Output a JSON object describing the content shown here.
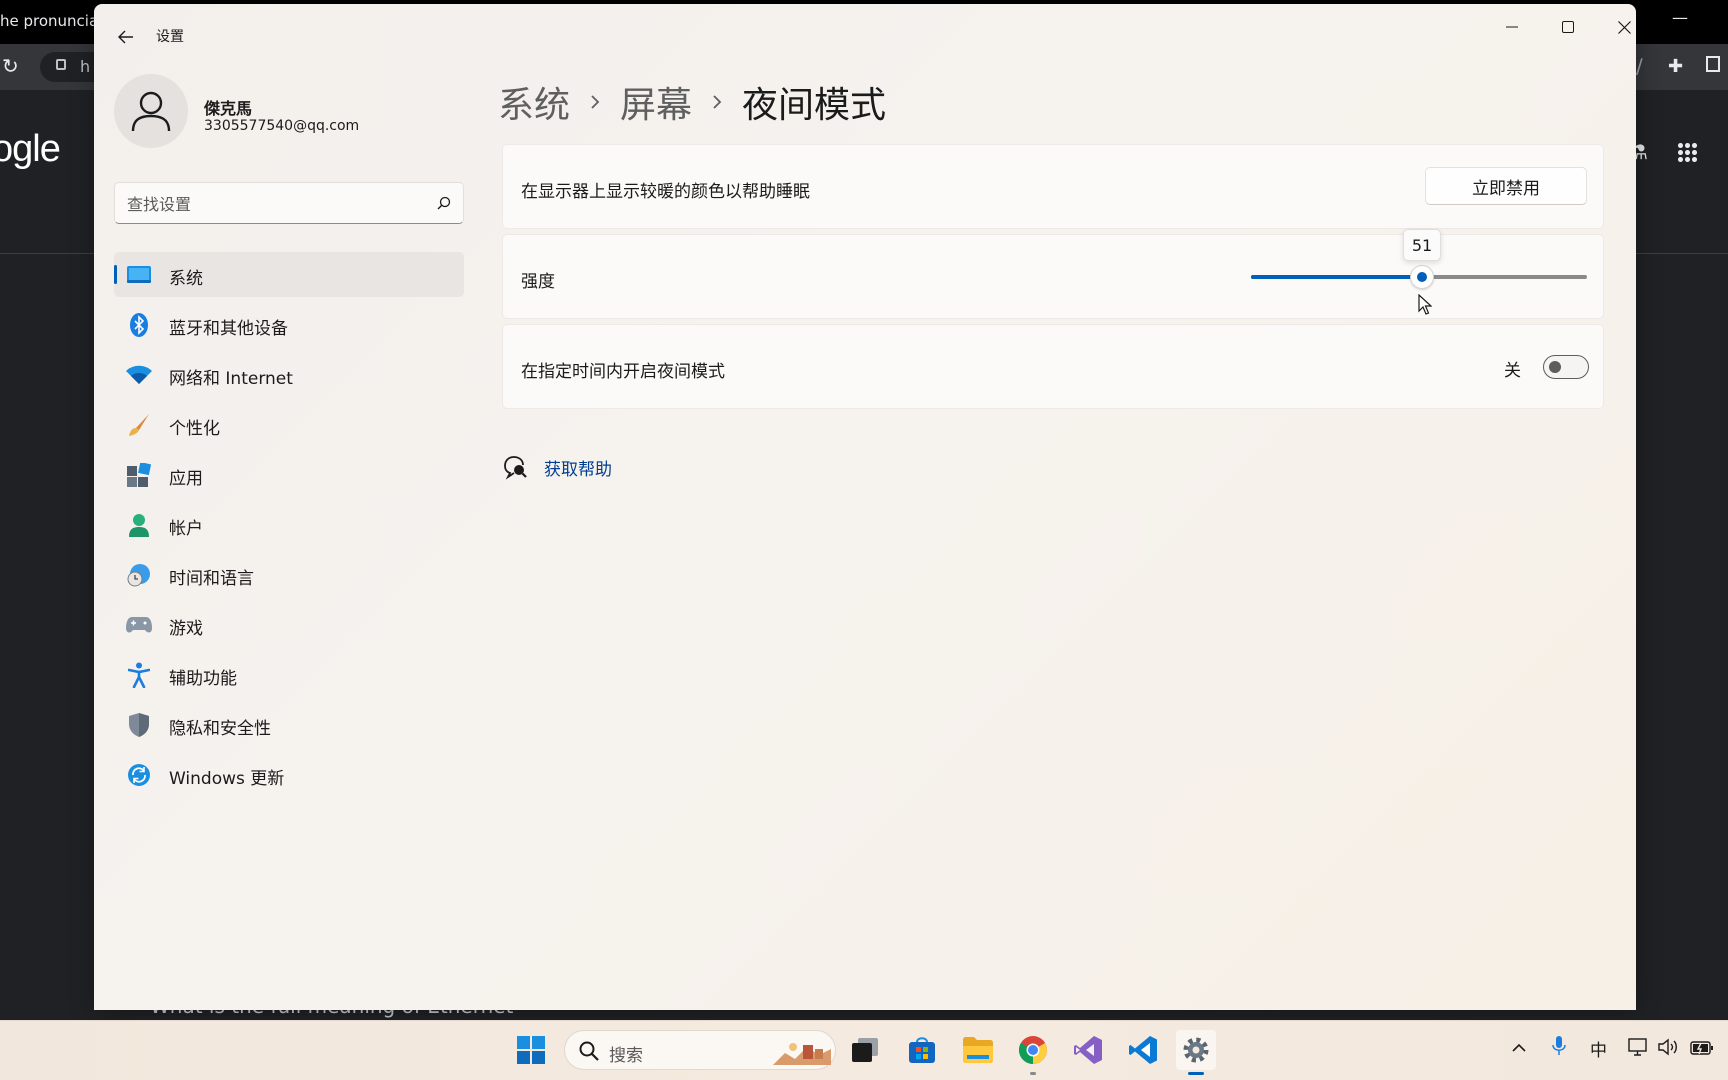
{
  "browser": {
    "tab_title": "he pronunciat",
    "url_fragment": "h",
    "logo_text": "ogle",
    "bottom_text": "What is the full meaning of Ethernet"
  },
  "window": {
    "app_title": "设置"
  },
  "profile": {
    "name": "傑克馬",
    "email": "3305577540@qq.com"
  },
  "search": {
    "placeholder": "查找设置"
  },
  "nav": {
    "items": [
      {
        "label": "系统",
        "icon": "system-icon",
        "active": true
      },
      {
        "label": "蓝牙和其他设备",
        "icon": "bluetooth-icon"
      },
      {
        "label": "网络和 Internet",
        "icon": "wifi-icon"
      },
      {
        "label": "个性化",
        "icon": "brush-icon"
      },
      {
        "label": "应用",
        "icon": "apps-icon"
      },
      {
        "label": "帐户",
        "icon": "account-icon"
      },
      {
        "label": "时间和语言",
        "icon": "globe-clock-icon"
      },
      {
        "label": "游戏",
        "icon": "gamepad-icon"
      },
      {
        "label": "辅助功能",
        "icon": "accessibility-icon"
      },
      {
        "label": "隐私和安全性",
        "icon": "shield-icon"
      },
      {
        "label": "Windows 更新",
        "icon": "update-icon"
      }
    ]
  },
  "breadcrumb": {
    "items": [
      "系统",
      "屏幕"
    ],
    "current": "夜间模式"
  },
  "night_light": {
    "description": "在显示器上显示较暖的颜色以帮助睡眠",
    "disable_button": "立即禁用",
    "strength_label": "强度",
    "strength_value": 51,
    "strength_text": "51",
    "schedule_label": "在指定时间内开启夜间模式",
    "schedule_state": "关",
    "schedule_on": false
  },
  "help": {
    "link": "获取帮助"
  },
  "taskbar": {
    "search_label": "搜索",
    "ime": "中"
  },
  "colors": {
    "accent": "#005fb8",
    "link": "#003e92"
  }
}
